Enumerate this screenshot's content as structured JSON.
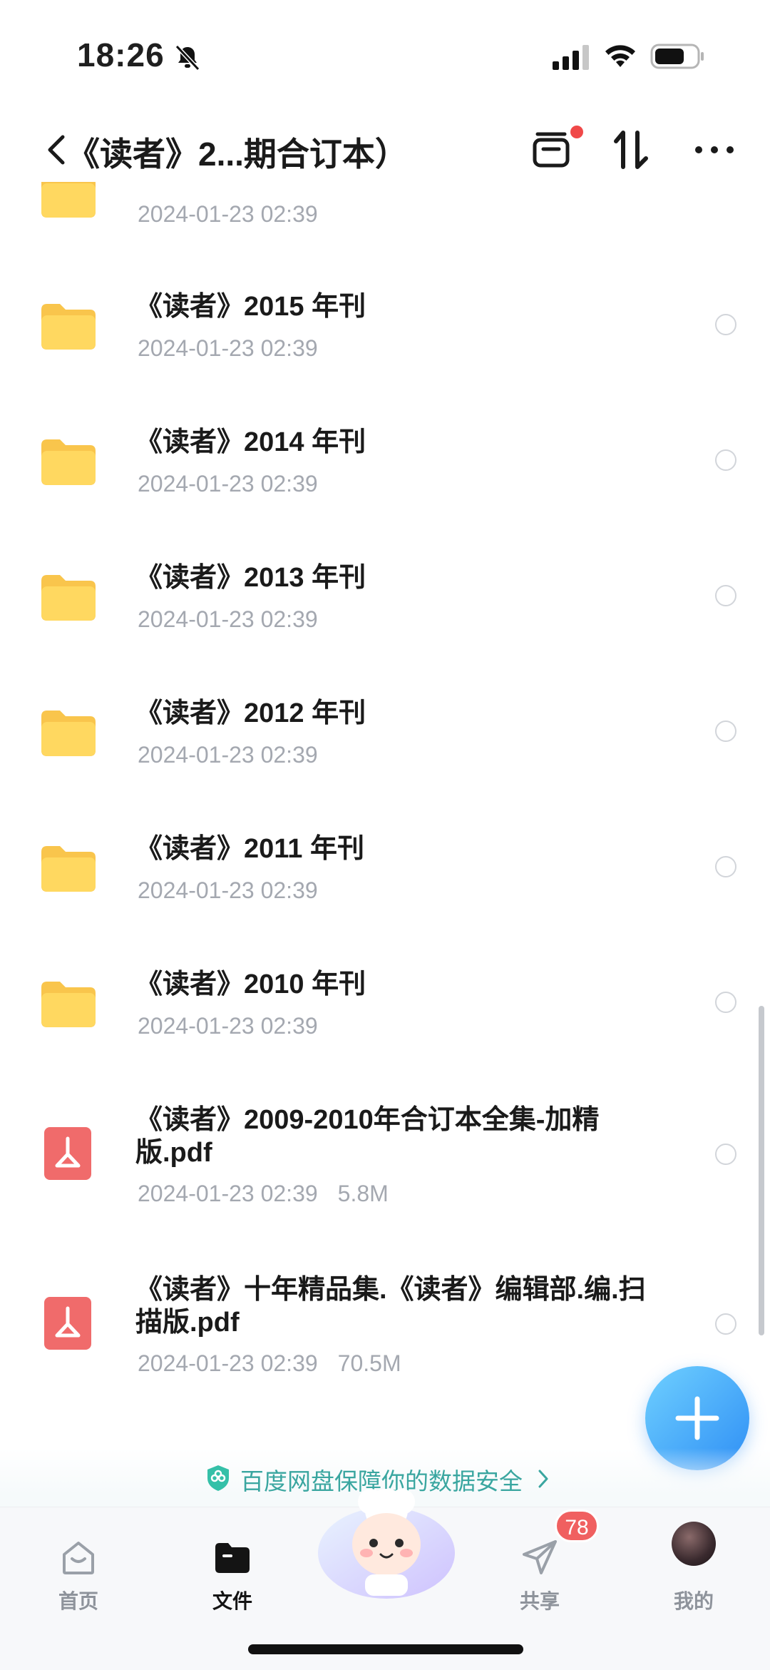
{
  "status": {
    "time": "18:26"
  },
  "nav": {
    "title": "《读者》2...期合订本）"
  },
  "files": [
    {
      "type": "folder",
      "name": "",
      "meta": "2024-01-23 02:39"
    },
    {
      "type": "folder",
      "name": "《读者》2015 年刊",
      "meta": "2024-01-23 02:39"
    },
    {
      "type": "folder",
      "name": "《读者》2014 年刊",
      "meta": "2024-01-23 02:39"
    },
    {
      "type": "folder",
      "name": "《读者》2013 年刊",
      "meta": "2024-01-23 02:39"
    },
    {
      "type": "folder",
      "name": "《读者》2012 年刊",
      "meta": "2024-01-23 02:39"
    },
    {
      "type": "folder",
      "name": "《读者》2011 年刊",
      "meta": "2024-01-23 02:39"
    },
    {
      "type": "folder",
      "name": "《读者》2010 年刊",
      "meta": "2024-01-23 02:39"
    },
    {
      "type": "pdf",
      "name": "《读者》2009-2010年合订本全集-加精版.pdf",
      "meta": "2024-01-23 02:39",
      "size": "5.8M"
    },
    {
      "type": "pdf",
      "name": "《读者》十年精品集.《读者》编辑部.编.扫描版.pdf",
      "meta": "2024-01-23 02:39",
      "size": "70.5M"
    }
  ],
  "security_banner": {
    "text": "百度网盘保障你的数据安全"
  },
  "tabs": [
    {
      "label": "首页",
      "icon": "home-icon"
    },
    {
      "label": "文件",
      "icon": "folder-icon"
    },
    {
      "label": "共享",
      "icon": "send-icon",
      "badge": "78"
    },
    {
      "label": "我的",
      "icon": "avatar"
    }
  ],
  "colors": {
    "accent": "#2f8ff5",
    "badge": "#f06060",
    "folder": "#ffd45a",
    "pdf": "#f06b6b"
  }
}
